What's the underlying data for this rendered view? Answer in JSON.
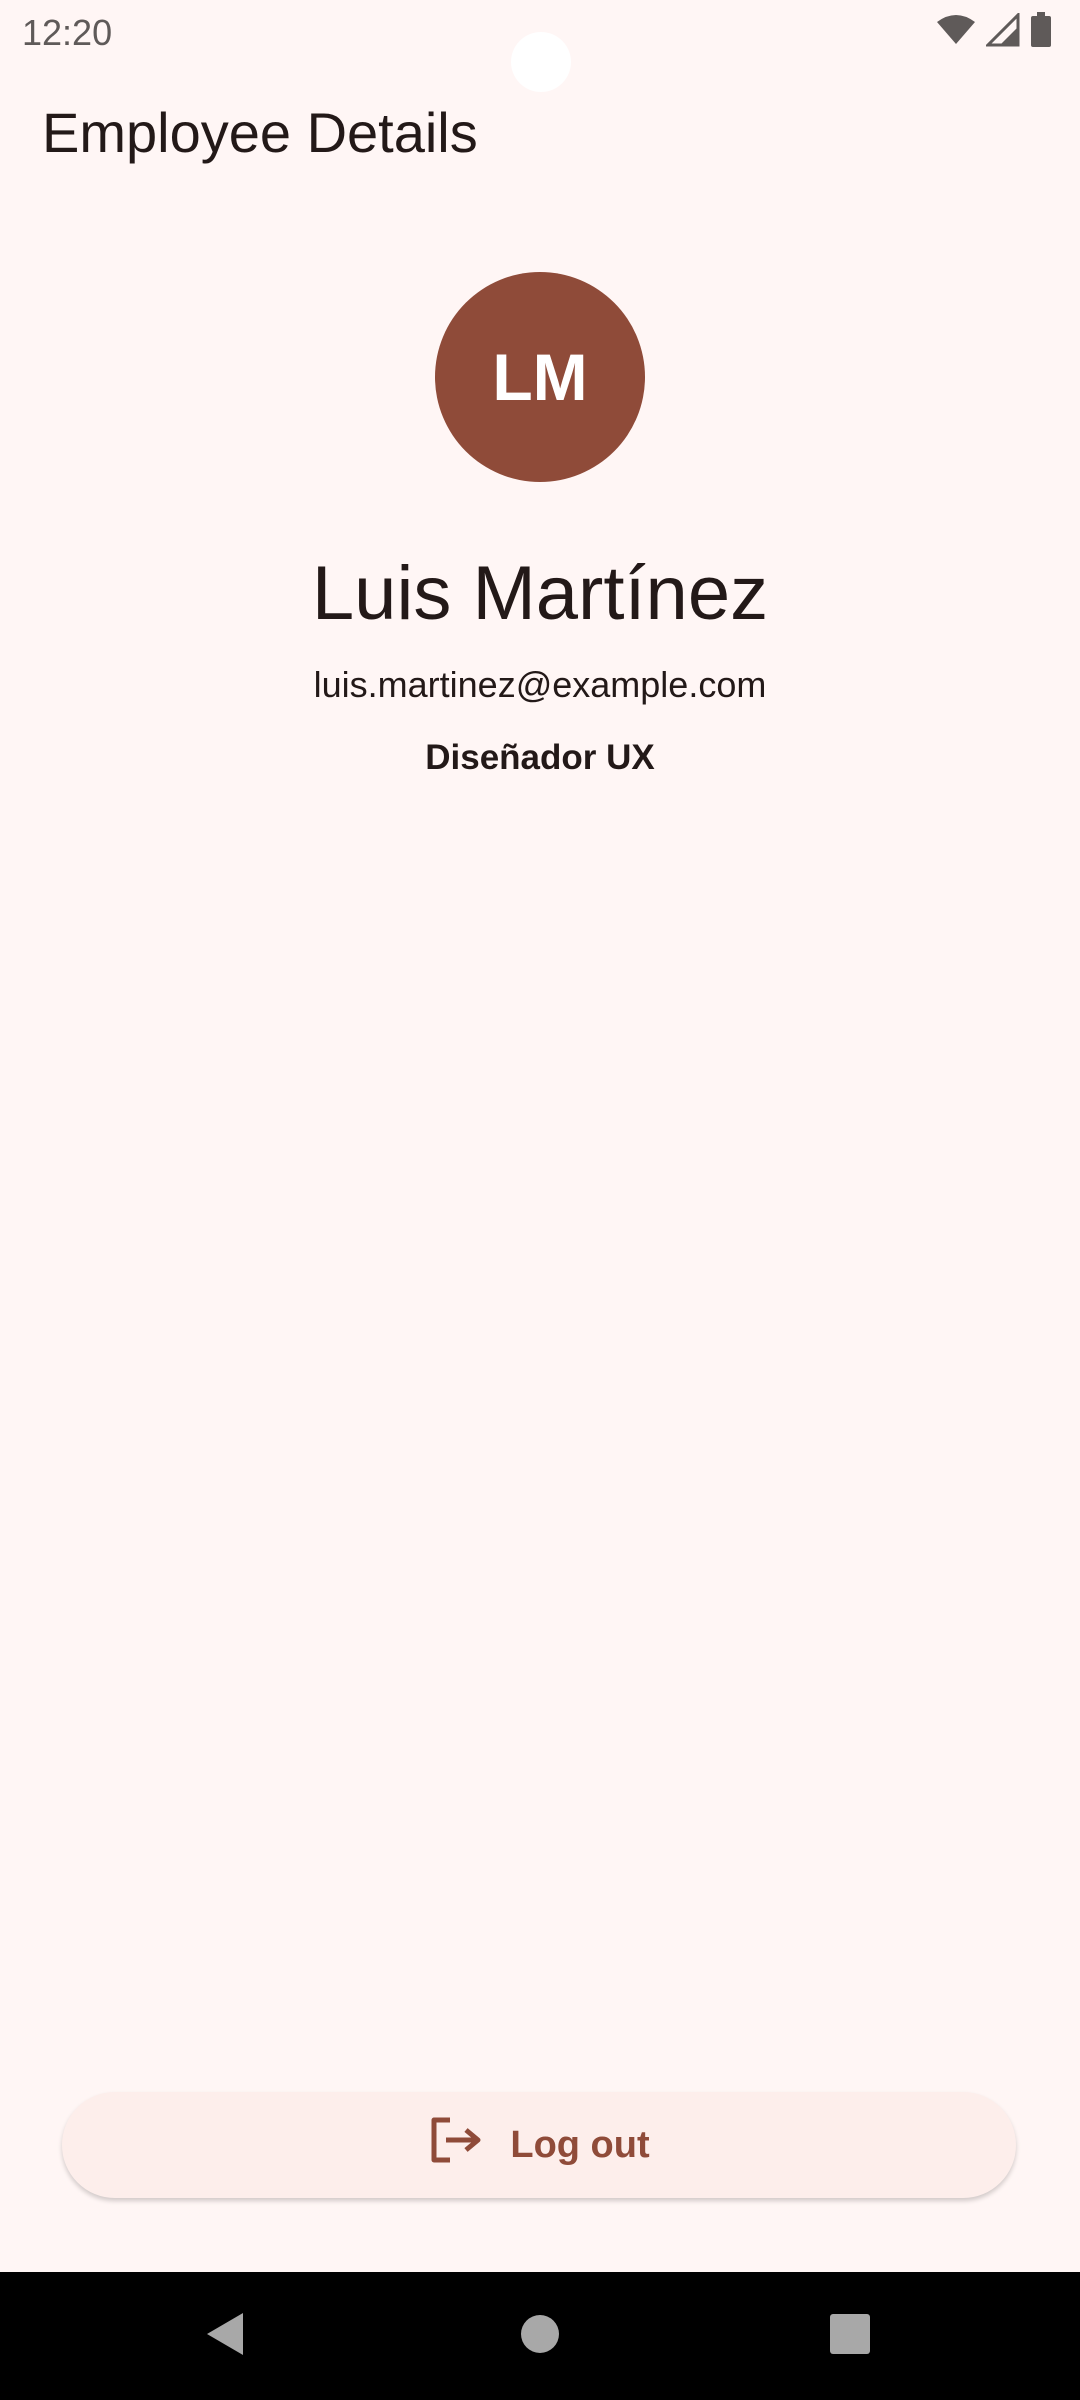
{
  "status_bar": {
    "time": "12:20",
    "icons": [
      "wifi-icon",
      "cellular-signal-icon",
      "battery-icon"
    ]
  },
  "app_bar": {
    "title": "Employee Details"
  },
  "profile": {
    "initials": "LM",
    "name": "Luis Martínez",
    "email": "luis.martinez@example.com",
    "role": "Diseñador UX"
  },
  "actions": {
    "logout_label": "Log out",
    "logout_icon": "logout-icon"
  },
  "navigation": {
    "buttons": [
      "back-icon",
      "home-icon",
      "recents-icon"
    ]
  },
  "colors": {
    "background": "#fff6f5",
    "accent": "#8f4b39",
    "button_background": "#fdeeeb",
    "nav_bar": "#000000"
  }
}
